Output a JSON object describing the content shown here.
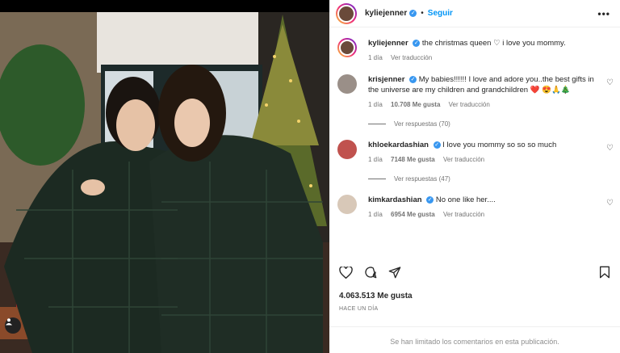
{
  "header": {
    "username": "kyliejenner",
    "verified_icon": "verified-badge-icon",
    "follow_label": "Seguir",
    "more_icon": "•••"
  },
  "caption": {
    "username": "kyliejenner",
    "text": "the christmas queen ♡ i love you mommy.",
    "time": "1 día",
    "translate": "Ver traducción"
  },
  "comments": [
    {
      "username": "krisjenner",
      "text": "My babies!!!!!! I love and adore you..the best gifts in the universe are my children and grandchildren ❤️ 😍🙏🎄",
      "time": "1 día",
      "likes": "10.708 Me gusta",
      "reply": "Ver traducción",
      "replies": "Ver respuestas (70)",
      "avatar_color": "#9a8f88"
    },
    {
      "username": "khloekardashian",
      "text": "I love you mommy so so so much",
      "time": "1 día",
      "likes": "7148 Me gusta",
      "reply": "Ver traducción",
      "replies": "Ver respuestas (47)",
      "avatar_color": "#c0524e"
    },
    {
      "username": "kimkardashian",
      "text": "No one like her....",
      "time": "1 día",
      "likes": "6954 Me gusta",
      "reply": "Ver traducción",
      "replies": "",
      "avatar_color": "#d8c8b8"
    }
  ],
  "actions": {
    "like_icon": "heart-icon",
    "comment_icon": "comment-icon",
    "share_icon": "share-icon",
    "save_icon": "bookmark-icon"
  },
  "likes_text": "4.063.513 Me gusta",
  "posted_ago": "HACE UN DÍA",
  "comments_limited": "Se han limitado los comentarios en esta publicación.",
  "colors": {
    "link": "#0095f6",
    "verified": "#3897f0",
    "muted": "#737373"
  }
}
